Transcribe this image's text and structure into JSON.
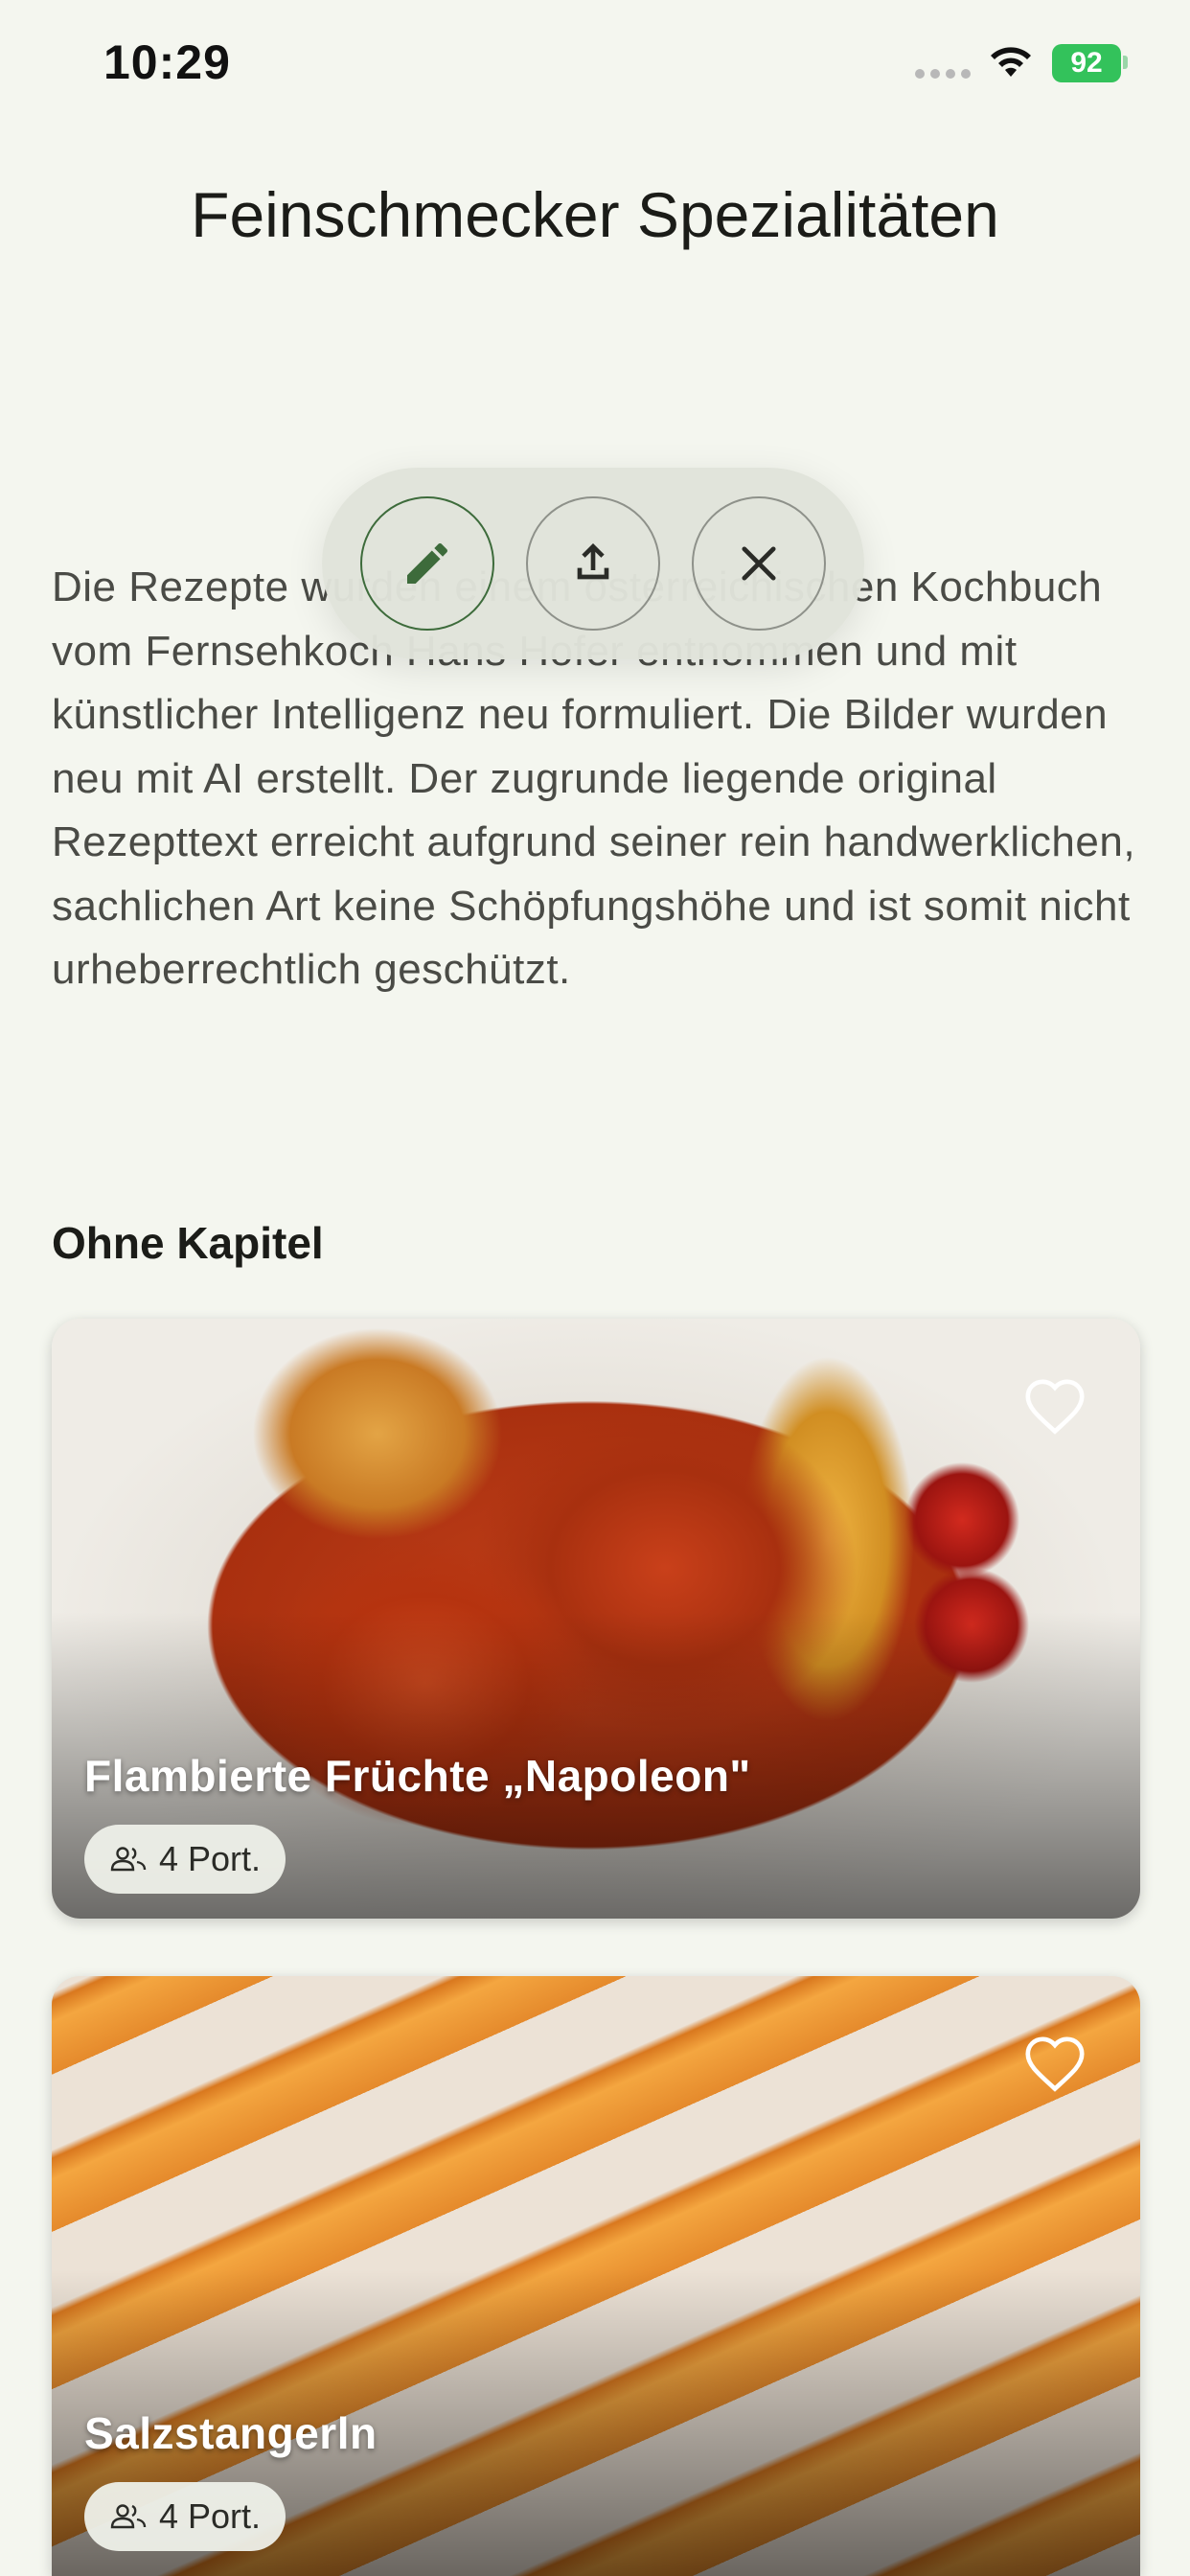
{
  "status_bar": {
    "time": "10:29",
    "battery": "92"
  },
  "header": {
    "title": "Feinschmecker Spezialitäten"
  },
  "description": "Die Rezepte wurden einem österreichischen Kochbuch vom Fernsehkoch Hans Hofer entnommen und mit künstlicher Intelligenz neu formuliert. Die Bilder wurden neu mit AI erstellt. Der zugrunde liegende original Rezepttext erreicht aufgrund seiner rein handwerklichen, sachlichen Art keine Schöpfungshöhe und ist somit nicht urheberrechtlich geschützt.",
  "actions": [
    {
      "icon": "pencil-icon"
    },
    {
      "icon": "share-upload-icon"
    },
    {
      "icon": "close-icon"
    }
  ],
  "section": {
    "heading": "Ohne Kapitel"
  },
  "recipes": [
    {
      "title": "Flambierte Früchte „Napoleon\"",
      "portions": "4 Port.",
      "favorite_icon": "heart-outline-icon",
      "portions_icon": "people-icon"
    },
    {
      "title": "Salzstangerln",
      "portions": "4 Port.",
      "favorite_icon": "heart-outline-icon",
      "portions_icon": "people-icon"
    }
  ],
  "colors": {
    "background": "#f4f6ef",
    "accent": "#3d6b3b",
    "battery": "#33c25b"
  }
}
